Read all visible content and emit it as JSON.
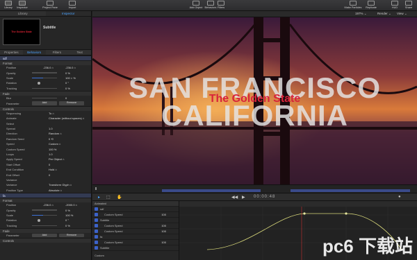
{
  "toolbar": {
    "left_buttons": [
      {
        "label": "Library",
        "icon": "library-icon"
      },
      {
        "label": "Inspector",
        "icon": "inspector-icon"
      },
      {
        "label": "Project Pane",
        "icon": "project-pane-icon"
      },
      {
        "label": "Import",
        "icon": "import-icon"
      }
    ],
    "center_buttons": [
      {
        "label": "Add Object",
        "icon": "add-object-icon"
      },
      {
        "label": "Behaviors",
        "icon": "behaviors-icon"
      },
      {
        "label": "Filters",
        "icon": "filters-icon"
      }
    ],
    "right_buttons": [
      {
        "label": "Make Particles",
        "icon": "particles-icon"
      },
      {
        "label": "Replicate",
        "icon": "replicate-icon"
      },
      {
        "label": "HUD",
        "icon": "hud-icon"
      },
      {
        "label": "Share",
        "icon": "share-icon"
      }
    ]
  },
  "left_tabs": [
    "Library",
    "Inspector"
  ],
  "preview": {
    "title": "Subtitle",
    "thumb_text": "The Golden State"
  },
  "inspector_tabs": [
    "Properties",
    "Behaviors",
    "Filters",
    "Text"
  ],
  "layer1": {
    "name": "sdf",
    "sections": {
      "format": "Format",
      "fade": "Fade",
      "controls": "Controls"
    },
    "format_rows": [
      {
        "label": "Position",
        "v1": "-236.0 ⌂",
        "v2": "-236.0 ⌂"
      },
      {
        "label": "Opacity",
        "v1": "0 %"
      },
      {
        "label": "Scale",
        "v1": "100 ⌂ %"
      },
      {
        "label": "Rotation",
        "v1": "0 °"
      },
      {
        "label": "Tracking",
        "v1": "0 %"
      }
    ],
    "fade_rows": [
      {
        "label": "Blur",
        "v1": "0"
      },
      {
        "label": "Parameter",
        "b1": "Add",
        "b2": "Remove"
      }
    ],
    "control_rows": [
      {
        "label": "Sequencing",
        "v1": "To ⌂"
      },
      {
        "label": "Animate",
        "v1": "Character (without spaces) ⌂"
      },
      {
        "label": "Select",
        "v1": ""
      },
      {
        "label": "Spread",
        "v1": "1.0"
      },
      {
        "label": "Direction",
        "v1": "Random ⌂"
      },
      {
        "label": "Random Seed",
        "v1": "0 ⟲"
      },
      {
        "label": "Speed",
        "v1": "Custom ⌂"
      },
      {
        "label": "Custom Speed",
        "v1": "100 %"
      },
      {
        "label": "Loops",
        "v1": "1.0"
      },
      {
        "label": "Apply Speed",
        "v1": "Per Object ⌂"
      },
      {
        "label": "Start Offset",
        "v1": "0"
      },
      {
        "label": "End Condition",
        "v1": "Hold ⌂"
      },
      {
        "label": "End Offset",
        "v1": "0"
      },
      {
        "label": "Variance",
        "v1": ""
      },
      {
        "label": "Variance",
        "v1": "Transform Glyph ⌂"
      },
      {
        "label": "Position Type",
        "v1": "Absolute ⌂"
      }
    ]
  },
  "layer2": {
    "name": "fa",
    "sections": {
      "format": "Format",
      "fade": "Fade",
      "controls": "Controls"
    },
    "format_rows": [
      {
        "label": "Position",
        "v1": "-236.0 ⌂",
        "v2": "-2000.0 ⌂"
      },
      {
        "label": "Opacity",
        "v1": "0 %"
      },
      {
        "label": "Scale",
        "v1": "100 %"
      },
      {
        "label": "Rotation",
        "v1": "0 °"
      },
      {
        "label": "Tracking",
        "v1": "0 %"
      }
    ],
    "fade_rows": [
      {
        "label": "Parameter",
        "b1": "Add",
        "b2": "Remove"
      }
    ]
  },
  "viewbar": {
    "zoom": "197% ⌄",
    "render": "Render ⌄",
    "view": "View ⌄"
  },
  "canvas": {
    "title_line1": "SAN FRANCISCO",
    "title_line2": "The Golden State",
    "title_line3": "CALIFORNIA"
  },
  "transport": {
    "timecode": "00:00:48",
    "colors": {
      "accent": "#4aa3ff"
    }
  },
  "keyframes": {
    "header": "Animated",
    "rows": [
      {
        "label": "sdf",
        "value": ""
      },
      {
        "label": "Custom Speed",
        "value": "100"
      },
      {
        "label": "Subtitle",
        "value": ""
      },
      {
        "label": "Custom Speed",
        "value": "100"
      },
      {
        "label": "Custom Speed",
        "value": "100"
      },
      {
        "label": "fa",
        "value": ""
      },
      {
        "label": "Custom Speed",
        "value": "100"
      },
      {
        "label": "Subtitle",
        "value": ""
      }
    ],
    "footer": "Custom"
  },
  "watermark": "pc6 下载站"
}
